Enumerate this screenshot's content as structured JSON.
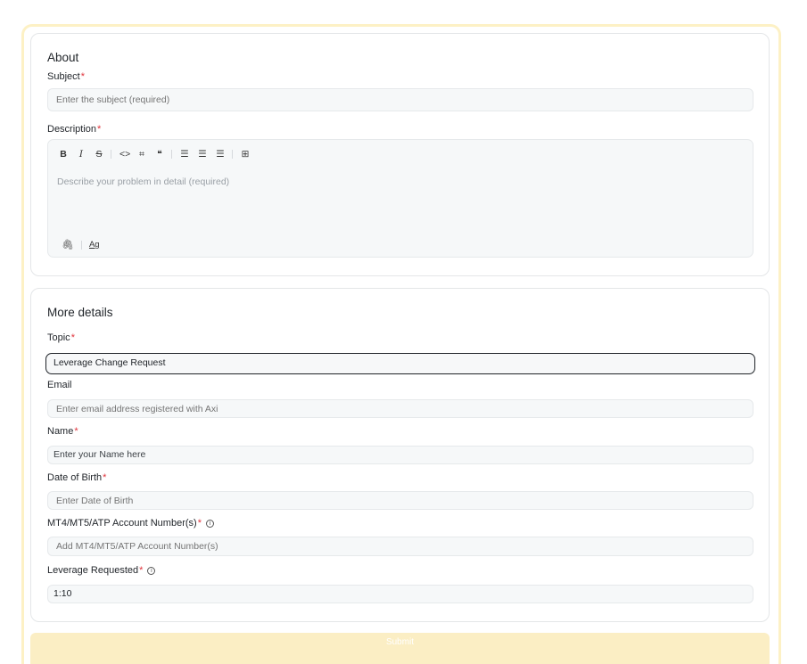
{
  "about": {
    "title": "About",
    "subject_label": "Subject",
    "subject_placeholder": "Enter the subject (required)",
    "description_label": "Description",
    "description_placeholder": "Describe your problem in detail (required)",
    "toolbar": [
      "B",
      "I",
      "S",
      "<>",
      "code-block",
      "quote",
      "bullet-list",
      "numbered-list",
      "checklist",
      "table"
    ],
    "footer_format": "Ag"
  },
  "more": {
    "title": "More details",
    "topic_label": "Topic",
    "topic_value": "Leverage Change Request",
    "email_label": "Email",
    "email_placeholder": "Enter email address registered with Axi",
    "name_label": "Name",
    "name_placeholder": "Enter your Name here",
    "dob_label": "Date of Birth",
    "dob_placeholder": "Enter Date of Birth",
    "account_label": "MT4/MT5/ATP Account Number(s)",
    "account_placeholder": "Add MT4/MT5/ATP Account Number(s)",
    "leverage_label": "Leverage Requested",
    "leverage_value": "1:10"
  },
  "submit_label": "Submit",
  "required_mark": "*",
  "colors": {
    "accent": "#fbeec4",
    "required": "#e0343c",
    "outer_border": "#fdf1c5"
  }
}
